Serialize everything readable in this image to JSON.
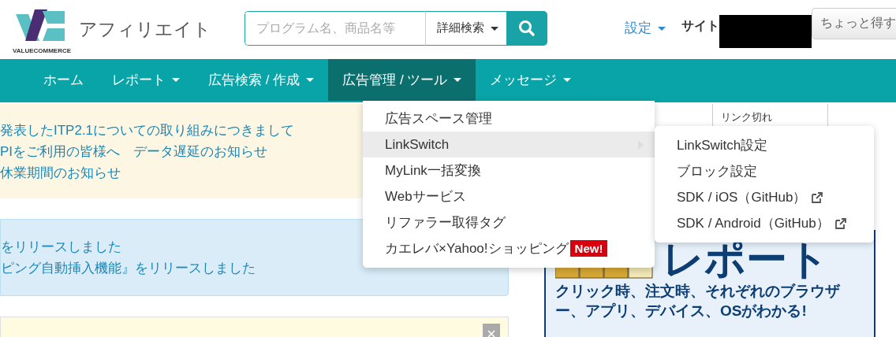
{
  "logo": {
    "wordmark": "VALUECOMMERCE",
    "title": "アフィリエイト"
  },
  "search": {
    "placeholder": "プログラム名、商品名等",
    "advanced": "詳細検索"
  },
  "settings": "設定",
  "site_label": "サイト",
  "promo_button": "ちょっと得す",
  "nav": [
    {
      "label": "ホーム",
      "dropdown": false,
      "selected": false
    },
    {
      "label": "レポート",
      "dropdown": true,
      "selected": false
    },
    {
      "label": "広告検索 / 作成",
      "dropdown": true,
      "selected": false
    },
    {
      "label": "広告管理 / ツール",
      "dropdown": true,
      "selected": true
    },
    {
      "label": "メッセージ",
      "dropdown": true,
      "selected": false
    }
  ],
  "menu": [
    {
      "label": "広告スペース管理",
      "hover": false,
      "submenu": false
    },
    {
      "label": "LinkSwitch",
      "hover": true,
      "submenu": true
    },
    {
      "label": "MyLink一括変換",
      "hover": false,
      "submenu": false
    },
    {
      "label": "Webサービス",
      "hover": false,
      "submenu": false
    },
    {
      "label": "リファラー取得タグ",
      "hover": false,
      "submenu": false
    },
    {
      "label": "カエレバ×Yahoo!ショッピング",
      "hover": false,
      "submenu": false,
      "badge": "New!"
    }
  ],
  "submenu": [
    {
      "label": "LinkSwitch設定",
      "external": false
    },
    {
      "label": "ブロック設定",
      "external": false
    },
    {
      "label": "SDK / iOS（GitHub）",
      "external": true
    },
    {
      "label": "SDK / Android（GitHub）",
      "external": true
    }
  ],
  "notices": [
    {
      "kind": "warning",
      "lines": [
        "発表したITP2.1についての取り組みにつきまして",
        "PIをご利用の皆様へ　データ遅延のお知らせ",
        "休業期間のお知らせ"
      ]
    },
    {
      "kind": "info",
      "lines": [
        "をリリースしました",
        "ピング自動挿入機能』をリリースしました"
      ]
    },
    {
      "kind": "note"
    }
  ],
  "stats": [
    {
      "label": "リンク切れ"
    }
  ],
  "banner": {
    "title": "レポート",
    "text": "クリック時、注文時、それぞれのブラウザー、アプリ、デバイス、OSがわかる!"
  }
}
